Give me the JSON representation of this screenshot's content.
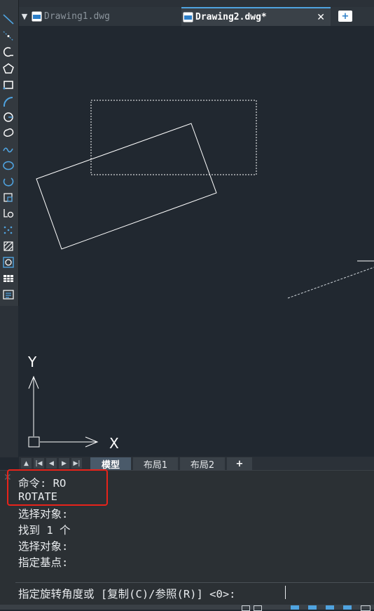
{
  "tabs": [
    {
      "label": "Drawing1.dwg",
      "active": false
    },
    {
      "label": "Drawing2.dwg*",
      "active": true
    }
  ],
  "tab_close_glyph": "✕",
  "tab_menu_glyph": "▼",
  "tab_new_glyph": "+",
  "drawing_tool_icons": [
    "line-icon",
    "construction-line-icon",
    "polyline-icon",
    "polygon-icon",
    "rectangle-icon",
    "arc-icon",
    "circle-icon",
    "revision-cloud-icon",
    "spline-icon",
    "ellipse-icon",
    "ellipse-arc-icon",
    "insert-block-icon",
    "make-block-icon",
    "point-icon",
    "hatch-icon",
    "region-icon",
    "table-icon",
    "multiline-text-icon"
  ],
  "ucs": {
    "x_label": "X",
    "y_label": "Y"
  },
  "layout_tabs": [
    {
      "label": "模型",
      "active": true
    },
    {
      "label": "布局1",
      "active": false
    },
    {
      "label": "布局2",
      "active": false
    },
    {
      "label": "+",
      "active": false
    }
  ],
  "layout_nav": [
    "▲",
    "|◀",
    "◀",
    "▶",
    "▶|"
  ],
  "command_history": [
    "命令: RO",
    "ROTATE",
    "选择对象:",
    "找到 1 个",
    "选择对象:",
    "指定基点:"
  ],
  "command_prompt": "指定旋转角度或 [复制(C)/参照(R)] <0>:",
  "command_close_glyph": "✕",
  "highlight_color": "#E8231A",
  "accent_color": "#4FA3E0"
}
